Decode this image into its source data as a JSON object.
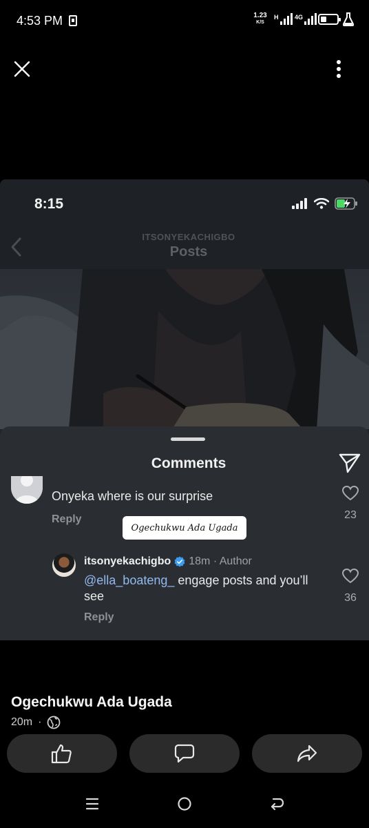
{
  "status_bar": {
    "time": "4:53 PM",
    "speed_value": "1.23",
    "speed_unit": "K/S",
    "net_h": "H",
    "net_4g": "4G"
  },
  "viewer": {
    "close_icon": "close-icon",
    "more_icon": "more-vertical-icon"
  },
  "embedded": {
    "status_time": "8:15",
    "header_username": "ITSONYEKACHIGBO",
    "header_title": "Posts",
    "comments_title": "Comments",
    "comment1": {
      "text": "Onyeka where is our surprise",
      "reply_label": "Reply",
      "likes": "23"
    },
    "tag_label": "Ogechukwu Ada Ugada",
    "comment2": {
      "username": "itsonyekachigbo",
      "meta": "18m · Author",
      "mention": "@ella_boateng_",
      "text": " engage posts and you’ll see",
      "reply_label": "Reply",
      "likes": "36"
    }
  },
  "post": {
    "author": "Ogechukwu Ada Ugada",
    "age": "20m",
    "separator": "·",
    "visibility_icon": "globe-icon",
    "actions": [
      "like-icon",
      "comment-icon",
      "share-icon"
    ]
  },
  "navbar": [
    "menu-icon",
    "home-icon",
    "back-icon"
  ],
  "colors": {
    "mention": "#93b9f1",
    "sheet_bg": "#2a2e33",
    "verified": "#3b9cf0"
  }
}
